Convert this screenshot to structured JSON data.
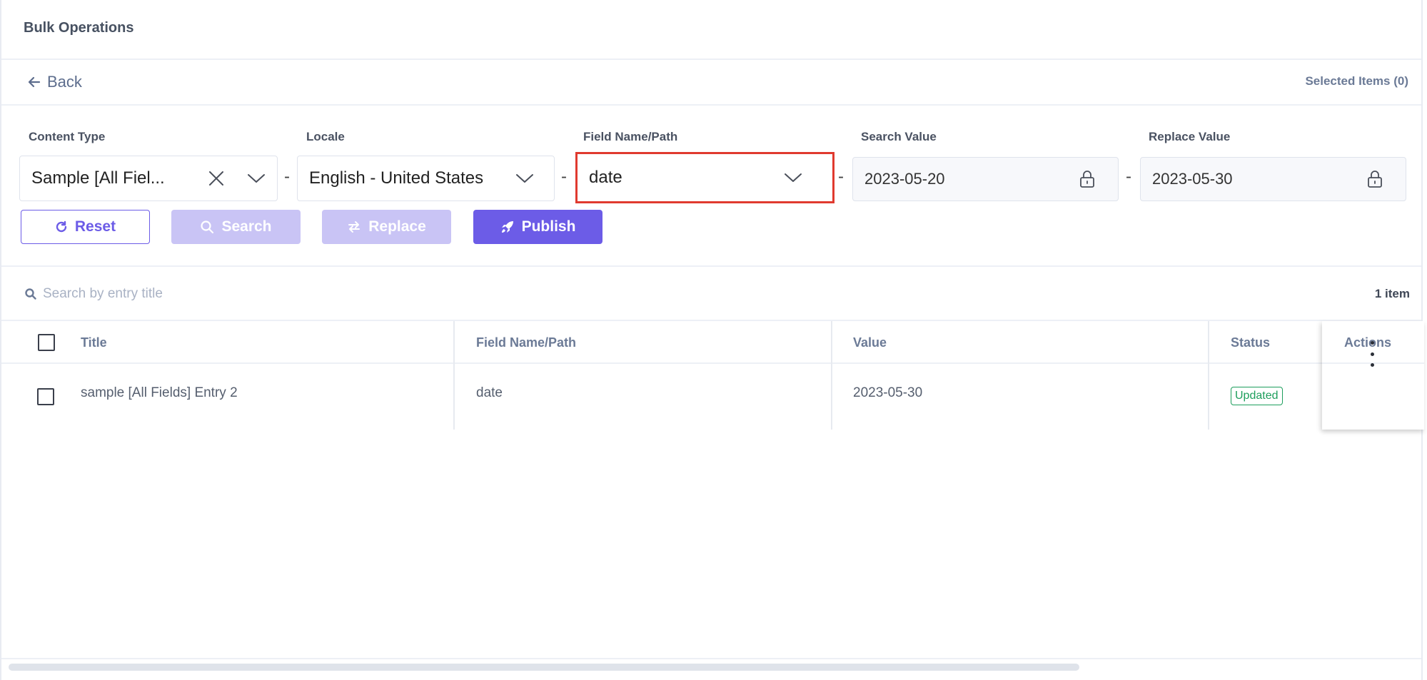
{
  "header": {
    "title": "Bulk Operations"
  },
  "nav": {
    "back_label": "Back",
    "selected_items": "Selected Items (0)"
  },
  "filters": {
    "content_type": {
      "label": "Content Type",
      "value": "Sample [All Fiel..."
    },
    "locale": {
      "label": "Locale",
      "value": "English - United States"
    },
    "field_path": {
      "label": "Field Name/Path",
      "value": "date"
    },
    "search_value": {
      "label": "Search Value",
      "value": "2023-05-20"
    },
    "replace_value": {
      "label": "Replace Value",
      "value": "2023-05-30"
    },
    "separator": "-"
  },
  "buttons": {
    "reset": "Reset",
    "search": "Search",
    "replace": "Replace",
    "publish": "Publish"
  },
  "entry_search": {
    "placeholder": "Search by entry title",
    "count": "1 item"
  },
  "table": {
    "columns": {
      "title": "Title",
      "field": "Field Name/Path",
      "value": "Value",
      "status": "Status",
      "actions": "Actions"
    },
    "rows": [
      {
        "title": "sample [All Fields] Entry 2",
        "field": "date",
        "value": "2023-05-30",
        "status": "Updated"
      }
    ]
  },
  "colors": {
    "accent": "#6c5ce7",
    "accent_disabled": "#c9c4f5",
    "status_success": "#1d9e5c",
    "highlight": "#e03a2f"
  },
  "icons": [
    "arrow-left-icon",
    "close-icon",
    "chevron-down-icon",
    "lock-icon",
    "refresh-icon",
    "search-icon",
    "swap-icon",
    "rocket-icon",
    "kebab-menu-icon"
  ]
}
